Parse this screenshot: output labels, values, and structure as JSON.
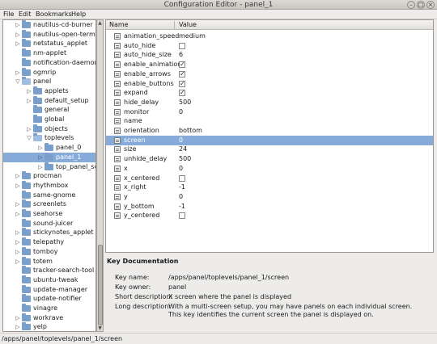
{
  "window": {
    "title": "Configuration Editor - panel_1",
    "buttons": [
      "–",
      "□",
      "×"
    ]
  },
  "menu": [
    "File",
    "Edit",
    "Bookmarks",
    "Help"
  ],
  "tree": [
    {
      "label": "nautilus-cd-burner",
      "indent": 1,
      "expander": "right",
      "selected": false
    },
    {
      "label": "nautilus-open-terminal",
      "indent": 1,
      "expander": "right",
      "selected": false
    },
    {
      "label": "netstatus_applet",
      "indent": 1,
      "expander": "right",
      "selected": false
    },
    {
      "label": "nm-applet",
      "indent": 1,
      "expander": "",
      "selected": false
    },
    {
      "label": "notification-daemon",
      "indent": 1,
      "expander": "",
      "selected": false
    },
    {
      "label": "ogmrip",
      "indent": 1,
      "expander": "right",
      "selected": false
    },
    {
      "label": "panel",
      "indent": 1,
      "expander": "down",
      "selected": false
    },
    {
      "label": "applets",
      "indent": 2,
      "expander": "right",
      "selected": false
    },
    {
      "label": "default_setup",
      "indent": 2,
      "expander": "right",
      "selected": false
    },
    {
      "label": "general",
      "indent": 2,
      "expander": "",
      "selected": false
    },
    {
      "label": "global",
      "indent": 2,
      "expander": "",
      "selected": false
    },
    {
      "label": "objects",
      "indent": 2,
      "expander": "right",
      "selected": false
    },
    {
      "label": "toplevels",
      "indent": 2,
      "expander": "down",
      "selected": false
    },
    {
      "label": "panel_0",
      "indent": 3,
      "expander": "right",
      "selected": false
    },
    {
      "label": "panel_1",
      "indent": 3,
      "expander": "right",
      "selected": true
    },
    {
      "label": "top_panel_screen",
      "indent": 3,
      "expander": "right",
      "selected": false
    },
    {
      "label": "procman",
      "indent": 1,
      "expander": "right",
      "selected": false
    },
    {
      "label": "rhythmbox",
      "indent": 1,
      "expander": "right",
      "selected": false
    },
    {
      "label": "same-gnome",
      "indent": 1,
      "expander": "",
      "selected": false
    },
    {
      "label": "screenlets",
      "indent": 1,
      "expander": "right",
      "selected": false
    },
    {
      "label": "seahorse",
      "indent": 1,
      "expander": "right",
      "selected": false
    },
    {
      "label": "sound-juicer",
      "indent": 1,
      "expander": "",
      "selected": false
    },
    {
      "label": "stickynotes_applet",
      "indent": 1,
      "expander": "right",
      "selected": false
    },
    {
      "label": "telepathy",
      "indent": 1,
      "expander": "right",
      "selected": false
    },
    {
      "label": "tomboy",
      "indent": 1,
      "expander": "right",
      "selected": false
    },
    {
      "label": "totem",
      "indent": 1,
      "expander": "right",
      "selected": false
    },
    {
      "label": "tracker-search-tool",
      "indent": 1,
      "expander": "",
      "selected": false
    },
    {
      "label": "ubuntu-tweak",
      "indent": 1,
      "expander": "",
      "selected": false
    },
    {
      "label": "update-manager",
      "indent": 1,
      "expander": "",
      "selected": false
    },
    {
      "label": "update-notifier",
      "indent": 1,
      "expander": "",
      "selected": false
    },
    {
      "label": "vinagre",
      "indent": 1,
      "expander": "",
      "selected": false
    },
    {
      "label": "workrave",
      "indent": 1,
      "expander": "right",
      "selected": false
    },
    {
      "label": "yelp",
      "indent": 1,
      "expander": "right",
      "selected": false
    }
  ],
  "table": {
    "columns": [
      "Name",
      "Value"
    ],
    "rows": [
      {
        "name": "animation_speed",
        "value": "medium",
        "type": "text"
      },
      {
        "name": "auto_hide",
        "value": "",
        "type": "bool",
        "checked": false
      },
      {
        "name": "auto_hide_size",
        "value": "6",
        "type": "text"
      },
      {
        "name": "enable_animations",
        "value": "",
        "type": "bool",
        "checked": true
      },
      {
        "name": "enable_arrows",
        "value": "",
        "type": "bool",
        "checked": true
      },
      {
        "name": "enable_buttons",
        "value": "",
        "type": "bool",
        "checked": true
      },
      {
        "name": "expand",
        "value": "",
        "type": "bool",
        "checked": true
      },
      {
        "name": "hide_delay",
        "value": "500",
        "type": "text"
      },
      {
        "name": "monitor",
        "value": "0",
        "type": "text"
      },
      {
        "name": "name",
        "value": "",
        "type": "text"
      },
      {
        "name": "orientation",
        "value": "bottom",
        "type": "text"
      },
      {
        "name": "screen",
        "value": "0",
        "type": "text",
        "selected": true
      },
      {
        "name": "size",
        "value": "24",
        "type": "text"
      },
      {
        "name": "unhide_delay",
        "value": "500",
        "type": "text"
      },
      {
        "name": "x",
        "value": "0",
        "type": "text"
      },
      {
        "name": "x_centered",
        "value": "",
        "type": "bool",
        "checked": false
      },
      {
        "name": "x_right",
        "value": "-1",
        "type": "text"
      },
      {
        "name": "y",
        "value": "0",
        "type": "text"
      },
      {
        "name": "y_bottom",
        "value": "-1",
        "type": "text"
      },
      {
        "name": "y_centered",
        "value": "",
        "type": "bool",
        "checked": false
      }
    ]
  },
  "doc": {
    "heading": "Key Documentation",
    "key_name_label": "Key name:",
    "key_name": "/apps/panel/toplevels/panel_1/screen",
    "key_owner_label": "Key owner:",
    "key_owner": "panel",
    "short_label": "Short description:",
    "short": "X screen where the panel is displayed",
    "long_label": "Long description:",
    "long": "With a multi-screen setup, you may have panels on each individual screen. This key identifies the current screen the panel is displayed on."
  },
  "statusbar": {
    "path": "/apps/panel/toplevels/panel_1/screen"
  }
}
